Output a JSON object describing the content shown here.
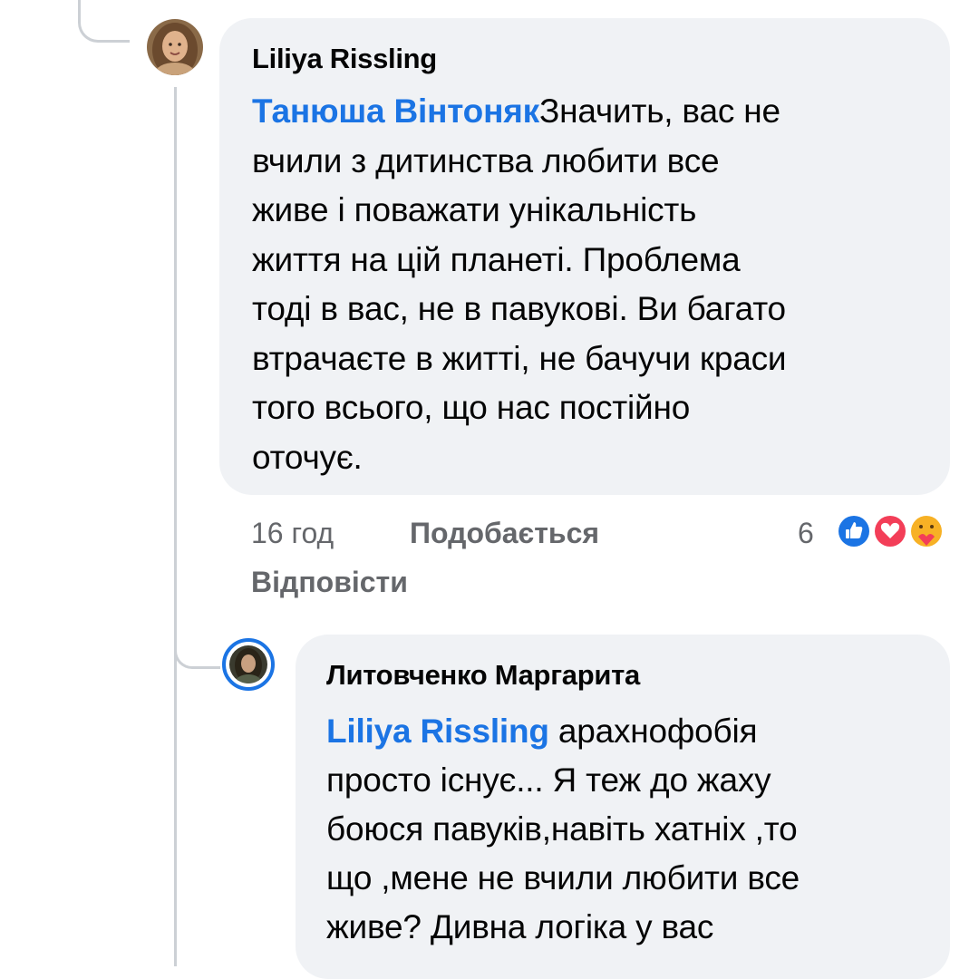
{
  "comment": {
    "author": "Liliya Rissling",
    "mention": "Танюша Вінтоняк",
    "lines": [
      "Значить, вас не",
      "вчили з дитинства любити все",
      "живе і поважати унікальність",
      "життя на цій планеті. Проблема",
      "тоді в вас, не в павукові. Ви багато",
      "втрачаєте в житті, не бачучи краси",
      "того всього, що нас постійно",
      "оточує."
    ],
    "timestamp": "16 год",
    "like_label": "Подобається",
    "reply_label": "Відповісти",
    "reaction_count": "6",
    "reactions": [
      "like-icon",
      "love-icon",
      "care-icon"
    ],
    "colors": {
      "mention": "#1b74e4",
      "bubble": "#f0f2f5",
      "meta": "#65676b",
      "like": "#1b74e4",
      "love": "#f33e58",
      "care": "#f7b125"
    }
  },
  "reply": {
    "author": "Литовченко Маргарита",
    "mention": "Liliya Rissling",
    "lines": [
      " арахнофобія",
      "просто існує... Я теж до жаху",
      "боюся павуків,навіть хатніх ,то",
      "що ,мене не вчили любити все",
      "живе? Дивна логіка у вас"
    ],
    "avatar_ring_color": "#1b74e4"
  }
}
